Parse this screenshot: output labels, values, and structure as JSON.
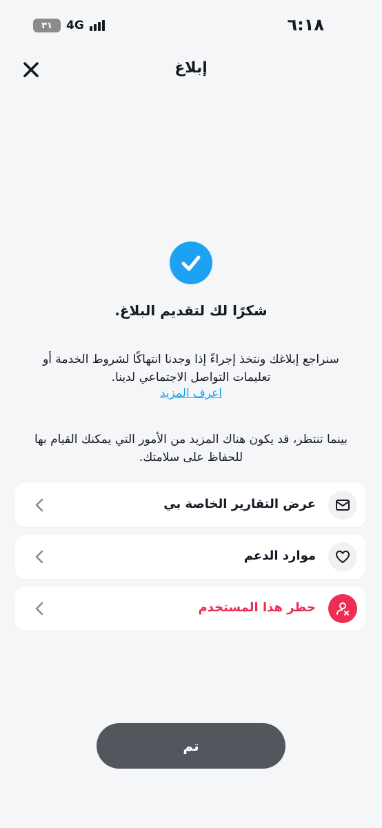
{
  "status_bar": {
    "time": "٦:١٨",
    "network": "4G",
    "battery": "٣١"
  },
  "header": {
    "title": "إبلاغ"
  },
  "confirmation": {
    "title": "شكرًا لك لتقديم البلاغ.",
    "description": "سنراجع إبلاغك ونتخذ إجراءً إذا وجدنا انتهاكًا لشروط الخدمة أو تعليمات التواصل الاجتماعي لدينا.",
    "learn_more": "اعرف المزيد",
    "meanwhile": "بينما تنتظر، قد يكون هناك المزيد من الأمور التي يمكنك القيام بها للحفاظ على سلامتك."
  },
  "options": [
    {
      "label": "عرض التقارير الخاصة بي",
      "icon": "envelope-icon"
    },
    {
      "label": "موارد الدعم",
      "icon": "heart-icon"
    },
    {
      "label": "حظر هذا المستخدم",
      "icon": "block-user-icon",
      "color": "#ee2d55"
    }
  ],
  "done_button": "تم",
  "colors": {
    "accent": "#1da1f2",
    "danger": "#ee2d55",
    "button": "#53565d",
    "background": "#f5f6f8"
  }
}
